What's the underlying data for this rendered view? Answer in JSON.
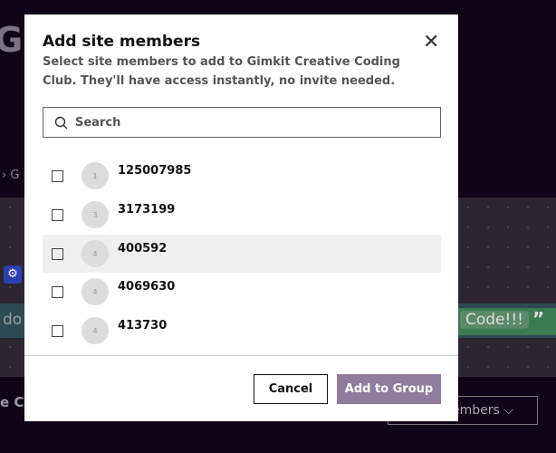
{
  "background": {
    "title_fragment": "Gi",
    "crumb_fragment": "› G",
    "do_fragment": "do",
    "code_label": "Code!!!",
    "quote": "”",
    "co_fragment": "e Co",
    "members_label": "embers ⌵"
  },
  "modal": {
    "title": "Add site members",
    "subtitle": "Select site members to add to Gimkit Creative Coding Club. They'll have access instantly, no invite needed.",
    "search_placeholder": "Search",
    "members": [
      {
        "initial": "1",
        "name": "125007985"
      },
      {
        "initial": "3",
        "name": "3173199"
      },
      {
        "initial": "4",
        "name": "400592"
      },
      {
        "initial": "4",
        "name": "4069630"
      },
      {
        "initial": "4",
        "name": "413730"
      }
    ],
    "cancel_label": "Cancel",
    "add_label": "Add to Group"
  }
}
